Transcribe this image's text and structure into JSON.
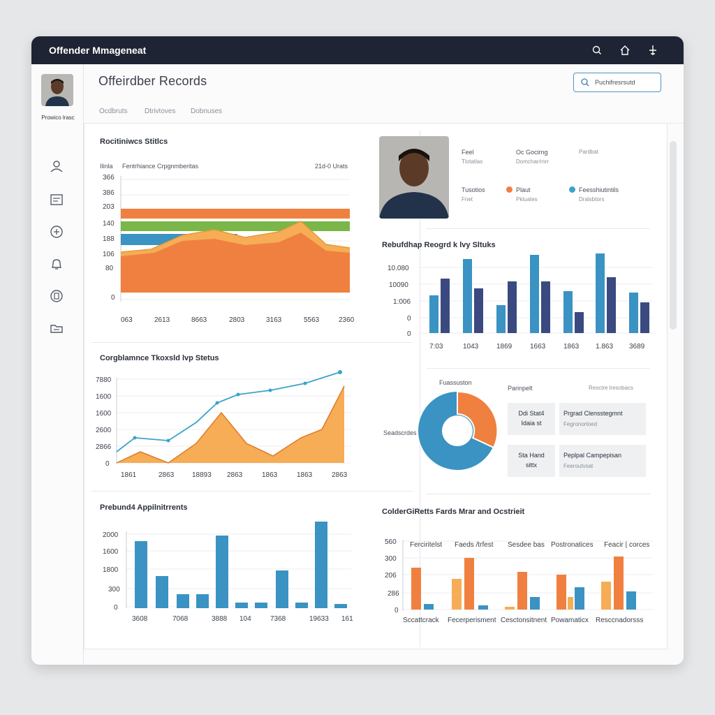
{
  "app": {
    "title": "Offender Mmageneat"
  },
  "titlebar_icons": [
    "search-icon",
    "home-icon",
    "settings-icon"
  ],
  "sidebar": {
    "user_name": "Prowico lrasc",
    "items": [
      "user-icon",
      "document-icon",
      "target-icon",
      "bell-icon",
      "shield-icon",
      "folder-icon"
    ]
  },
  "page": {
    "title": "Offeirdber Records",
    "search_value": "Puchifresrsutd",
    "tabs": [
      "Ocdbruts",
      "Dtrivtoves",
      "Dobnuses"
    ]
  },
  "colors": {
    "orange": "#f08040",
    "green": "#7ab648",
    "blue": "#3a93c2",
    "navy": "#3a4a80",
    "amber": "#f6ad55"
  },
  "panels": {
    "residents": {
      "title": "Rocitiniwcs Stitlcs",
      "sub_left": "Ilinla",
      "sub_mid": "Fentrhiance Crpgnmberitas",
      "sub_right": "21d-0 Urats",
      "yticks": [
        "366",
        "386",
        "203",
        "140",
        "188",
        "106",
        "80",
        "0"
      ],
      "xticks": [
        "063",
        "2613",
        "8663",
        "2803",
        "3163",
        "5563",
        "2360"
      ],
      "bars": [
        {
          "name": "Orange band",
          "value": 1.0
        },
        {
          "name": "Green band",
          "value": 1.0
        },
        {
          "name": "Blue band",
          "value": 0.5
        }
      ]
    },
    "compliance": {
      "title": "Corgblamnce Tkoxsld lvp Stetus",
      "yticks": [
        "7880",
        "1600",
        "1600",
        "2600",
        "2866",
        "0"
      ],
      "xticks": [
        "1861",
        "2863",
        "18893",
        "2863",
        "1863",
        "1863",
        "2863"
      ]
    },
    "appointments": {
      "title": "Prebund4 Appilnitrrents",
      "yticks": [
        "2000",
        "1600",
        "1800",
        "300",
        "0"
      ],
      "xticks": [
        "3608",
        "7068",
        "3888",
        "104",
        "7368",
        "19633",
        "161"
      ]
    },
    "profile": {
      "fields": [
        {
          "label": "Feel",
          "value": "Tlotatlas"
        },
        {
          "label": "Oc Gocirng",
          "value": "Domchar/rnrr"
        },
        {
          "label": "Pardbat",
          "value": ""
        },
        {
          "label": "Tusotios",
          "value": "Fnet"
        },
        {
          "label": "Plaut",
          "value": "Pkluates"
        },
        {
          "label": "Feesshiutintils",
          "value": "Dralsbtors"
        }
      ]
    },
    "status": {
      "title": "Rebufdhap Reogrd k lvy Sltuks",
      "yticks": [
        "10.080",
        "10090",
        "1:006",
        "0",
        "0"
      ],
      "xticks": [
        "7:03",
        "1043",
        "1869",
        "1663",
        "1863",
        "1.863",
        "3689"
      ]
    },
    "donut": {
      "top_label": "Fuassuston",
      "left_label": "Seadscrdes",
      "right_title": "Parinpelt",
      "right_sub": "Resctre   lresobacs",
      "slices": [
        {
          "name": "Blue",
          "value": 0.7
        },
        {
          "name": "Orange",
          "value": 0.3
        }
      ],
      "cards": [
        {
          "badge": "Ddi Stat4 Idaia st",
          "title": "Prgrad Clensstegmnt",
          "sub": "Fegronortoed"
        },
        {
          "badge": "Sta Hand sittx",
          "title": "Peplpal Campepisan",
          "sub": "Feeroutvsat"
        }
      ]
    },
    "fields_chart": {
      "title": "ColderGiRetts Fards Mrar and Ocstrieit",
      "yticks": [
        "560",
        "300",
        "206",
        "286",
        "0"
      ],
      "groups": [
        "Ferciritelst",
        "Faeds /trfest",
        "Sesdee bas",
        "Postronatices",
        "Feacir | corces"
      ],
      "xticks": [
        "Sccattcrack",
        "Fecerperisment",
        "Cesctonsitnent",
        "Powamaticx",
        "Resccnadorsss"
      ]
    }
  }
}
